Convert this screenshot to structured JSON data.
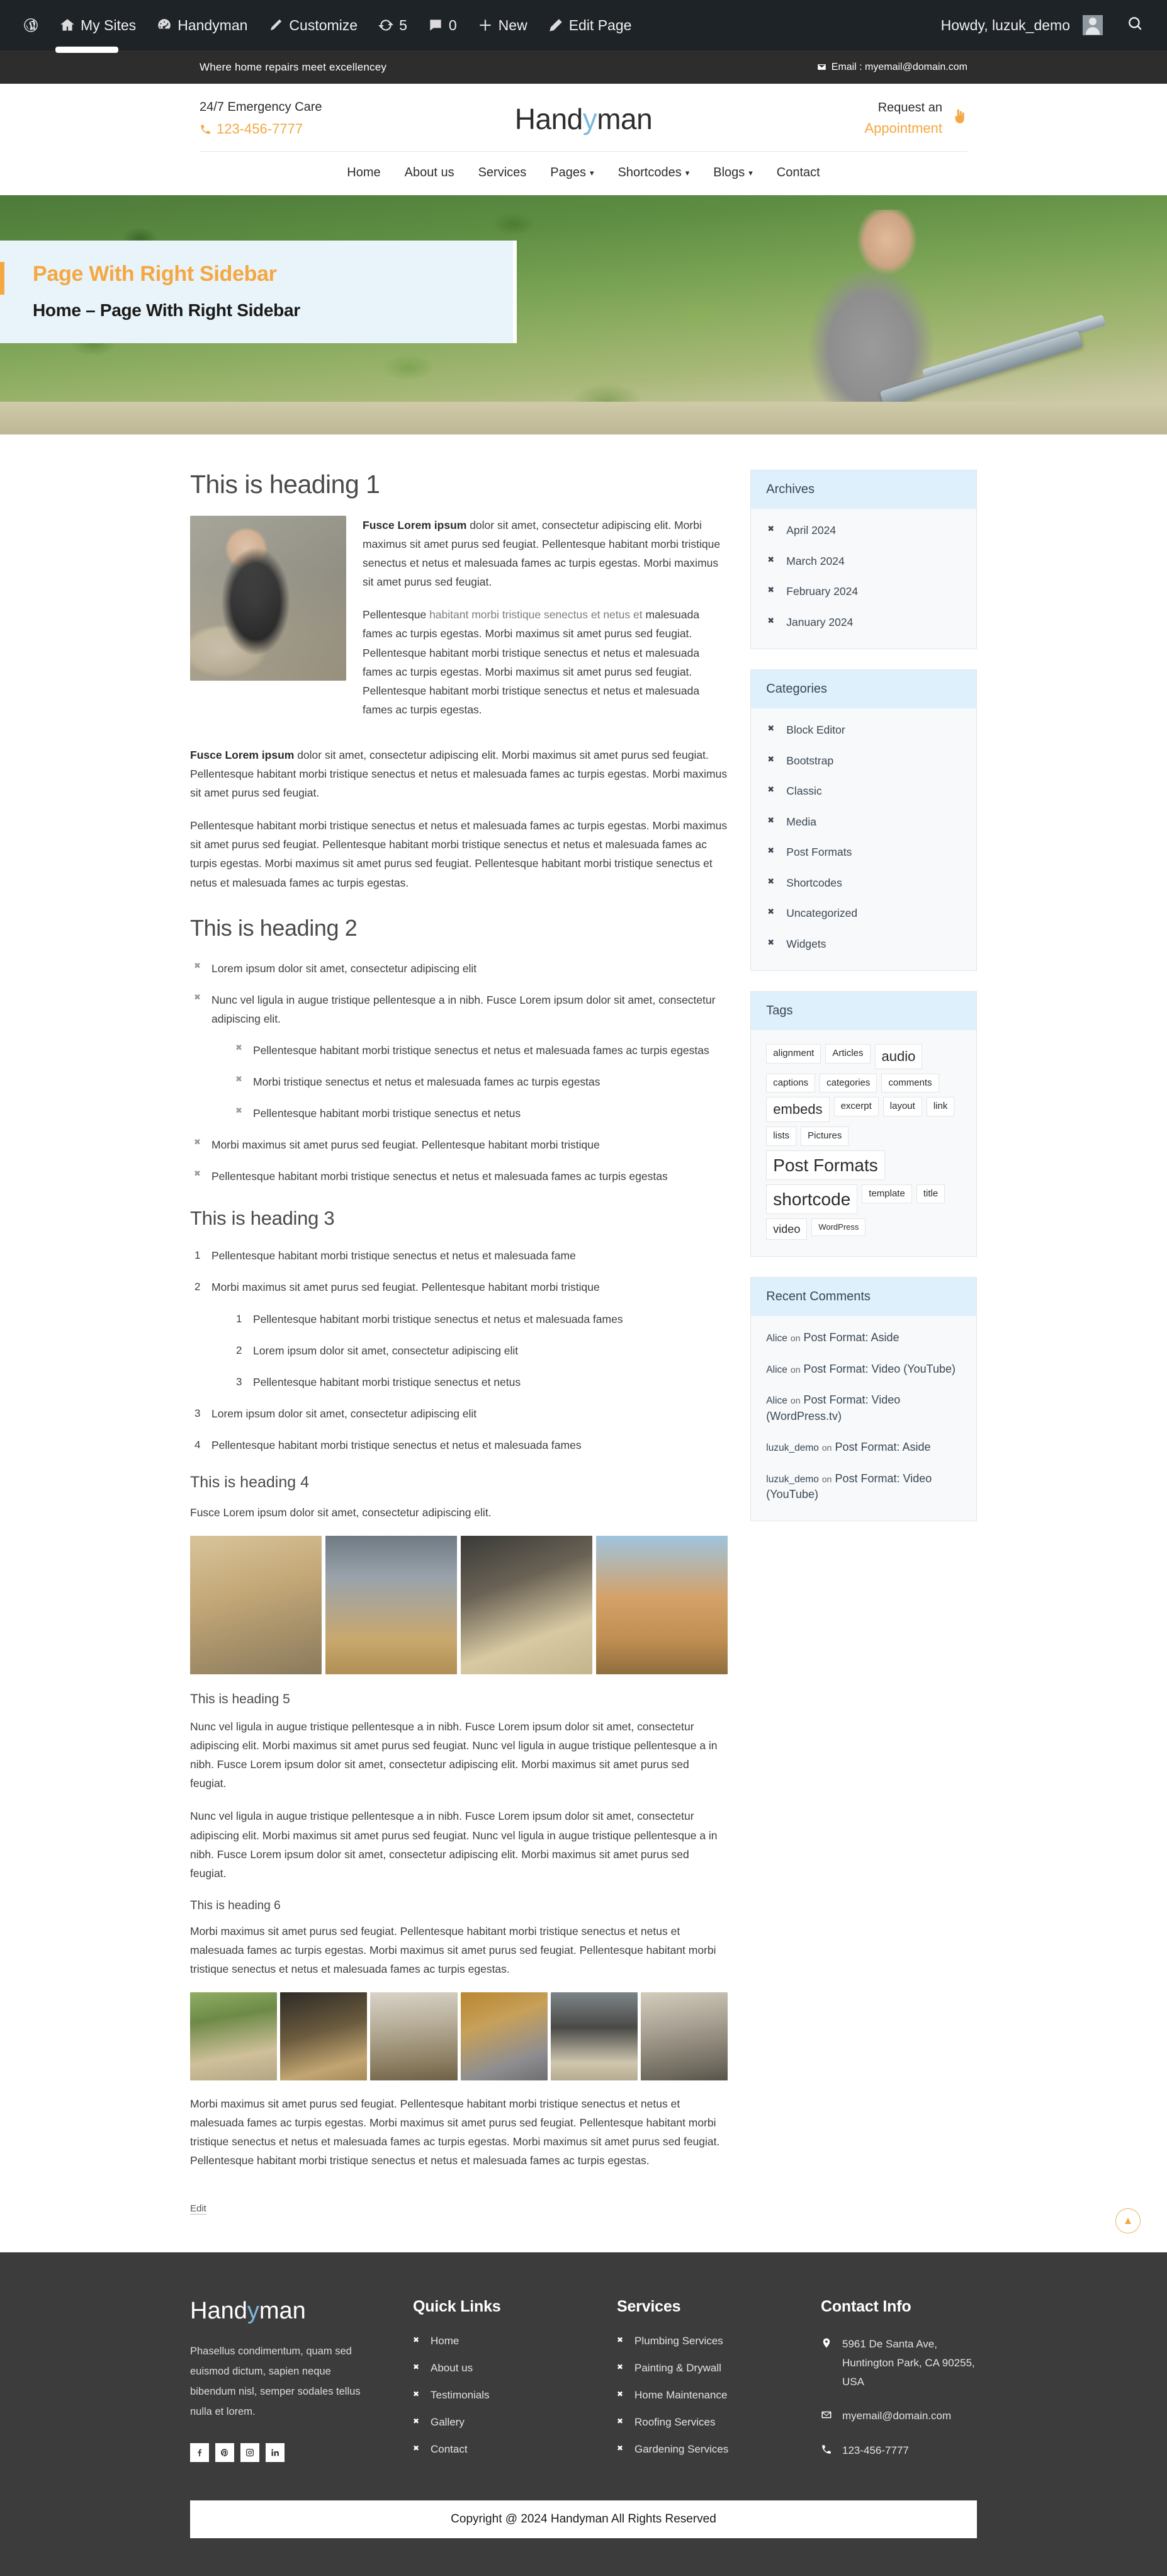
{
  "adminbar": {
    "items": [
      {
        "icon": "wordpress-icon",
        "label": ""
      },
      {
        "icon": "sites-icon",
        "label": "My Sites"
      },
      {
        "icon": "dashboard-icon",
        "label": "Handyman"
      },
      {
        "icon": "pencil-icon",
        "label": "Customize"
      },
      {
        "icon": "updates-icon",
        "label": "5"
      },
      {
        "icon": "comments-icon",
        "label": "0"
      },
      {
        "icon": "plus-icon",
        "label": "New"
      },
      {
        "icon": "edit-icon",
        "label": "Edit Page"
      }
    ],
    "howdy": "Howdy, luzuk_demo",
    "avatar_name": "user-avatar",
    "search_name": "search-icon"
  },
  "topbar": {
    "tagline": "Where home repairs meet excellencey",
    "email_label": "Email : myemail@domain.com"
  },
  "header": {
    "emergency_label": "24/7 Emergency Care",
    "phone": "123-456-7777",
    "brand_pre": "Hand",
    "brand_y": "y",
    "brand_post": "man",
    "appointment_line1": "Request an",
    "appointment_line2": "Appointment"
  },
  "nav": {
    "items": [
      {
        "label": "Home",
        "caret": false
      },
      {
        "label": "About us",
        "caret": false
      },
      {
        "label": "Services",
        "caret": false
      },
      {
        "label": "Pages",
        "caret": true
      },
      {
        "label": "Shortcodes",
        "caret": true
      },
      {
        "label": "Blogs",
        "caret": true
      },
      {
        "label": "Contact",
        "caret": false
      }
    ]
  },
  "breadcrumb": {
    "title": "Page With Right Sidebar",
    "path": "Home – Page With Right Sidebar"
  },
  "content": {
    "h1": "This is heading 1",
    "intro_p1_bold": "Fusce Lorem ipsum",
    "intro_p1_rest": " dolor sit amet, consectetur adipiscing elit. Morbi maximus sit amet purus sed feugiat. Pellentesque habitant morbi tristique senectus et netus et malesuada fames ac turpis egestas. Morbi maximus sit amet purus sed feugiat.",
    "intro_p2_lead": "Pellentesque ",
    "intro_p2_soft": "habitant morbi tristique senectus et netus et",
    "intro_p2_rest": " malesuada fames ac turpis egestas. Morbi maximus sit amet purus sed feugiat. Pellentesque habitant morbi tristique senectus et netus et malesuada fames ac turpis egestas. Morbi maximus sit amet purus sed feugiat. Pellentesque habitant morbi tristique senectus et netus et malesuada fames ac turpis egestas.",
    "p3_bold": "Fusce Lorem ipsum",
    "p3_rest": " dolor sit amet, consectetur adipiscing elit. Morbi maximus sit amet purus sed feugiat. Pellentesque habitant morbi tristique senectus et netus et malesuada fames ac turpis egestas. Morbi maximus sit amet purus sed feugiat.",
    "p4": "Pellentesque habitant morbi tristique senectus et netus et malesuada fames ac turpis egestas. Morbi maximus sit amet purus sed feugiat. Pellentesque habitant morbi tristique senectus et netus et malesuada fames ac turpis egestas. Morbi maximus sit amet purus sed feugiat. Pellentesque habitant morbi tristique senectus et netus et malesuada fames ac turpis egestas.",
    "h2": "This is heading 2",
    "ul_items": [
      "Lorem ipsum dolor sit amet, consectetur adipiscing elit",
      "Nunc vel ligula in augue tristique pellentesque a in nibh. Fusce Lorem ipsum dolor sit amet, consectetur adipiscing elit.",
      "Morbi maximus sit amet purus sed feugiat. Pellentesque habitant morbi tristique",
      "Pellentesque habitant morbi tristique senectus et netus et malesuada fames ac turpis egestas"
    ],
    "ul_nested": [
      "Pellentesque habitant morbi tristique senectus et netus et malesuada fames ac turpis egestas",
      "Morbi tristique senectus et netus et malesuada fames ac turpis egestas",
      "Pellentesque habitant morbi tristique senectus et netus"
    ],
    "h3": "This is heading 3",
    "ol_items": [
      "Pellentesque habitant morbi tristique senectus et netus et malesuada fame",
      "Morbi maximus sit amet purus sed feugiat. Pellentesque habitant morbi tristique",
      "Lorem ipsum dolor sit amet, consectetur adipiscing elit",
      "Pellentesque habitant morbi tristique senectus et netus et malesuada fames"
    ],
    "ol_nested": [
      "Pellentesque habitant morbi tristique senectus et netus et malesuada fames",
      "Lorem ipsum dolor sit amet, consectetur adipiscing elit",
      "Pellentesque habitant morbi tristique senectus et netus"
    ],
    "h4": "This is heading 4",
    "h4_p": "Fusce Lorem ipsum dolor sit amet, consectetur adipiscing elit.",
    "h5": "This is heading 5",
    "h5_p1": "Nunc vel ligula in augue tristique pellentesque a in nibh. Fusce Lorem ipsum dolor sit amet, consectetur adipiscing elit. Morbi maximus sit amet purus sed feugiat. Nunc vel ligula in augue tristique pellentesque a in nibh. Fusce Lorem ipsum dolor sit amet, consectetur adipiscing elit. Morbi maximus sit amet purus sed feugiat.",
    "h5_p2": "Nunc vel ligula in augue tristique pellentesque a in nibh. Fusce Lorem ipsum dolor sit amet, consectetur adipiscing elit. Morbi maximus sit amet purus sed feugiat. Nunc vel ligula in augue tristique pellentesque a in nibh. Fusce Lorem ipsum dolor sit amet, consectetur adipiscing elit. Morbi maximus sit amet purus sed feugiat.",
    "h6": "This is heading 6",
    "h6_p1": "Morbi maximus sit amet purus sed feugiat. Pellentesque habitant morbi tristique senectus et netus et malesuada fames ac turpis egestas. Morbi maximus sit amet purus sed feugiat. Pellentesque habitant morbi tristique senectus et netus et malesuada fames ac turpis egestas.",
    "h6_p2": "Morbi maximus sit amet purus sed feugiat. Pellentesque habitant morbi tristique senectus et netus et malesuada fames ac turpis egestas. Morbi maximus sit amet purus sed feugiat. Pellentesque habitant morbi tristique senectus et netus et malesuada fames ac turpis egestas. Morbi maximus sit amet purus sed feugiat. Pellentesque habitant morbi tristique senectus et netus et malesuada fames ac turpis egestas.",
    "edit_label": "Edit"
  },
  "sidebar": {
    "archives": {
      "title": "Archives",
      "items": [
        "April 2024",
        "March 2024",
        "February 2024",
        "January 2024"
      ]
    },
    "categories": {
      "title": "Categories",
      "items": [
        "Block Editor",
        "Bootstrap",
        "Classic",
        "Media",
        "Post Formats",
        "Shortcodes",
        "Uncategorized",
        "Widgets"
      ]
    },
    "tags": {
      "title": "Tags",
      "items": [
        {
          "label": "alignment",
          "size": "ts-s"
        },
        {
          "label": "Articles",
          "size": "ts-s"
        },
        {
          "label": "audio",
          "size": "ts-l"
        },
        {
          "label": "captions",
          "size": "ts-s"
        },
        {
          "label": "categories",
          "size": "ts-s"
        },
        {
          "label": "comments",
          "size": "ts-s"
        },
        {
          "label": "embeds",
          "size": "ts-l"
        },
        {
          "label": "excerpt",
          "size": "ts-s"
        },
        {
          "label": "layout",
          "size": "ts-s"
        },
        {
          "label": "link",
          "size": "ts-s"
        },
        {
          "label": "lists",
          "size": "ts-s"
        },
        {
          "label": "Pictures",
          "size": "ts-s"
        },
        {
          "label": "Post Formats",
          "size": "ts-xl"
        },
        {
          "label": "shortcode",
          "size": "ts-xl"
        },
        {
          "label": "template",
          "size": "ts-s"
        },
        {
          "label": "title",
          "size": "ts-s"
        },
        {
          "label": "video",
          "size": "ts-m"
        },
        {
          "label": "WordPress",
          "size": "ts-xs"
        }
      ]
    },
    "recent_comments": {
      "title": "Recent Comments",
      "items": [
        {
          "author": "Alice",
          "on": "on",
          "post": "Post Format: Aside"
        },
        {
          "author": "Alice",
          "on": "on",
          "post": "Post Format: Video (YouTube)"
        },
        {
          "author": "Alice",
          "on": "on",
          "post": "Post Format: Video (WordPress.tv)"
        },
        {
          "author": "luzuk_demo",
          "on": "on",
          "post": "Post Format: Aside"
        },
        {
          "author": "luzuk_demo",
          "on": "on",
          "post": "Post Format: Video (YouTube)"
        }
      ]
    },
    "scroll_top_icon": "chevron-up-icon"
  },
  "footer": {
    "brand_pre": "Hand",
    "brand_y": "y",
    "brand_post": "man",
    "about": "Phasellus condimentum, quam sed euismod dictum, sapien neque bibendum nisl, semper sodales tellus nulla et lorem.",
    "socials": [
      "facebook-icon",
      "pinterest-icon",
      "instagram-icon",
      "linkedin-icon"
    ],
    "quick_links": {
      "title": "Quick Links",
      "items": [
        "Home",
        "About us",
        "Testimonials",
        "Gallery",
        "Contact"
      ]
    },
    "services": {
      "title": "Services",
      "items": [
        "Plumbing Services",
        "Painting & Drywall",
        "Home Maintenance",
        "Roofing Services",
        "Gardening Services"
      ]
    },
    "contact": {
      "title": "Contact Info",
      "address": "5961 De Santa Ave, Huntington Park, CA 90255, USA",
      "email": "myemail@domain.com",
      "phone": "123-456-7777"
    },
    "copyright": "Copyright @ 2024 Handyman All Rights Reserved"
  },
  "colors": {
    "accent": "#f5a742",
    "widget_head": "#ddf0fb",
    "footer_bg": "#3c3c3c",
    "adminbar_bg": "#1d2327",
    "topbar_bg": "#2d2d2d",
    "brand_blue": "#7fb8dd"
  }
}
